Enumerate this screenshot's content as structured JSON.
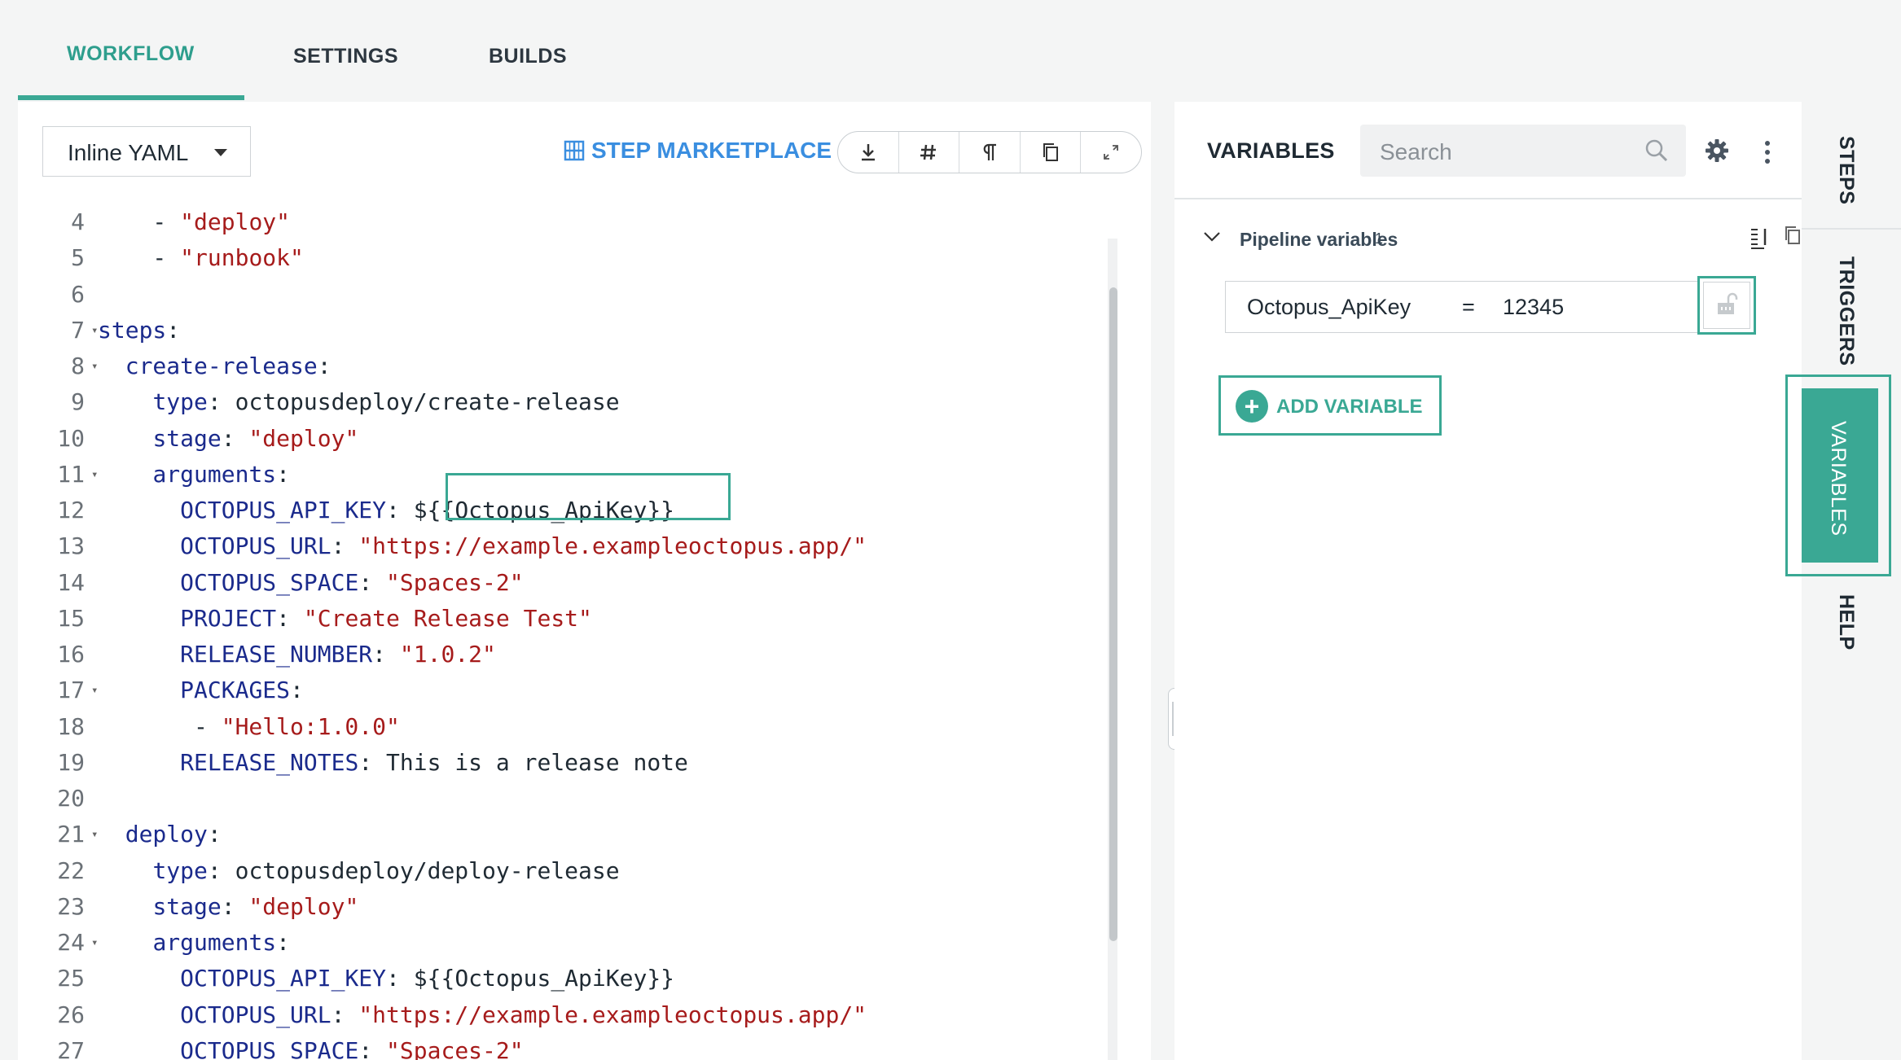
{
  "tabs": {
    "workflow": "WORKFLOW",
    "settings": "SETTINGS",
    "builds": "BUILDS"
  },
  "editor": {
    "mode": "Inline YAML",
    "marketplace": "STEP MARKETPLACE",
    "toolbar": [
      "download-icon",
      "hash-icon",
      "pilcrow-icon",
      "copy-icon",
      "expand-icon"
    ],
    "lines": [
      {
        "n": "4",
        "fold": false,
        "parts": [
          [
            "p",
            "    - "
          ],
          [
            "s",
            "\"deploy\""
          ]
        ]
      },
      {
        "n": "5",
        "fold": false,
        "parts": [
          [
            "p",
            "    - "
          ],
          [
            "s",
            "\"runbook\""
          ]
        ]
      },
      {
        "n": "6",
        "fold": false,
        "parts": []
      },
      {
        "n": "7",
        "fold": true,
        "parts": [
          [
            "k",
            "steps"
          ],
          [
            "p",
            ":"
          ]
        ]
      },
      {
        "n": "8",
        "fold": true,
        "parts": [
          [
            "p",
            "  "
          ],
          [
            "k",
            "create-release"
          ],
          [
            "p",
            ":"
          ]
        ]
      },
      {
        "n": "9",
        "fold": false,
        "parts": [
          [
            "p",
            "    "
          ],
          [
            "k",
            "type"
          ],
          [
            "p",
            ": octopusdeploy/create-release"
          ]
        ]
      },
      {
        "n": "10",
        "fold": false,
        "parts": [
          [
            "p",
            "    "
          ],
          [
            "k",
            "stage"
          ],
          [
            "p",
            ": "
          ],
          [
            "s",
            "\"deploy\""
          ]
        ]
      },
      {
        "n": "11",
        "fold": true,
        "parts": [
          [
            "p",
            "    "
          ],
          [
            "k",
            "arguments"
          ],
          [
            "p",
            ":"
          ]
        ]
      },
      {
        "n": "12",
        "fold": false,
        "parts": [
          [
            "p",
            "      "
          ],
          [
            "k",
            "OCTOPUS_API_KEY"
          ],
          [
            "p",
            ": ${{Octopus_ApiKey}}"
          ]
        ]
      },
      {
        "n": "13",
        "fold": false,
        "parts": [
          [
            "p",
            "      "
          ],
          [
            "k",
            "OCTOPUS_URL"
          ],
          [
            "p",
            ": "
          ],
          [
            "s",
            "\"https://example.exampleoctopus.app/\""
          ]
        ]
      },
      {
        "n": "14",
        "fold": false,
        "parts": [
          [
            "p",
            "      "
          ],
          [
            "k",
            "OCTOPUS_SPACE"
          ],
          [
            "p",
            ": "
          ],
          [
            "s",
            "\"Spaces-2\""
          ]
        ]
      },
      {
        "n": "15",
        "fold": false,
        "parts": [
          [
            "p",
            "      "
          ],
          [
            "k",
            "PROJECT"
          ],
          [
            "p",
            ": "
          ],
          [
            "s",
            "\"Create Release Test\""
          ]
        ]
      },
      {
        "n": "16",
        "fold": false,
        "parts": [
          [
            "p",
            "      "
          ],
          [
            "k",
            "RELEASE_NUMBER"
          ],
          [
            "p",
            ": "
          ],
          [
            "s",
            "\"1.0.2\""
          ]
        ]
      },
      {
        "n": "17",
        "fold": true,
        "parts": [
          [
            "p",
            "      "
          ],
          [
            "k",
            "PACKAGES"
          ],
          [
            "p",
            ":"
          ]
        ]
      },
      {
        "n": "18",
        "fold": false,
        "parts": [
          [
            "p",
            "       - "
          ],
          [
            "s",
            "\"Hello:1.0.0\""
          ]
        ]
      },
      {
        "n": "19",
        "fold": false,
        "parts": [
          [
            "p",
            "      "
          ],
          [
            "k",
            "RELEASE_NOTES"
          ],
          [
            "p",
            ": This is a release note"
          ]
        ]
      },
      {
        "n": "20",
        "fold": false,
        "parts": []
      },
      {
        "n": "21",
        "fold": true,
        "parts": [
          [
            "p",
            "  "
          ],
          [
            "k",
            "deploy"
          ],
          [
            "p",
            ":"
          ]
        ]
      },
      {
        "n": "22",
        "fold": false,
        "parts": [
          [
            "p",
            "    "
          ],
          [
            "k",
            "type"
          ],
          [
            "p",
            ": octopusdeploy/deploy-release"
          ]
        ]
      },
      {
        "n": "23",
        "fold": false,
        "parts": [
          [
            "p",
            "    "
          ],
          [
            "k",
            "stage"
          ],
          [
            "p",
            ": "
          ],
          [
            "s",
            "\"deploy\""
          ]
        ]
      },
      {
        "n": "24",
        "fold": true,
        "parts": [
          [
            "p",
            "    "
          ],
          [
            "k",
            "arguments"
          ],
          [
            "p",
            ":"
          ]
        ]
      },
      {
        "n": "25",
        "fold": false,
        "parts": [
          [
            "p",
            "      "
          ],
          [
            "k",
            "OCTOPUS_API_KEY"
          ],
          [
            "p",
            ": ${{Octopus_ApiKey}}"
          ]
        ]
      },
      {
        "n": "26",
        "fold": false,
        "parts": [
          [
            "p",
            "      "
          ],
          [
            "k",
            "OCTOPUS_URL"
          ],
          [
            "p",
            ": "
          ],
          [
            "s",
            "\"https://example.exampleoctopus.app/\""
          ]
        ]
      },
      {
        "n": "27",
        "fold": false,
        "parts": [
          [
            "p",
            "      "
          ],
          [
            "k",
            "OCTOPUS_SPACE"
          ],
          [
            "p",
            ": "
          ],
          [
            "s",
            "\"Spaces-2\""
          ]
        ]
      }
    ]
  },
  "variables": {
    "title": "VARIABLES",
    "search_placeholder": "Search",
    "section_label": "Pipeline variables",
    "section_count": "1",
    "var_name": "Octopus_ApiKey",
    "var_eq": "=",
    "var_value": "12345",
    "add_label": "ADD VARIABLE"
  },
  "rail": {
    "steps": "STEPS",
    "triggers": "TRIGGERS",
    "variables": "VARIABLES",
    "help": "HELP"
  },
  "colors": {
    "accent": "#3aa894",
    "link": "#3a8ee0",
    "yaml_key": "#1a2a8c",
    "yaml_string": "#a61b1b"
  }
}
